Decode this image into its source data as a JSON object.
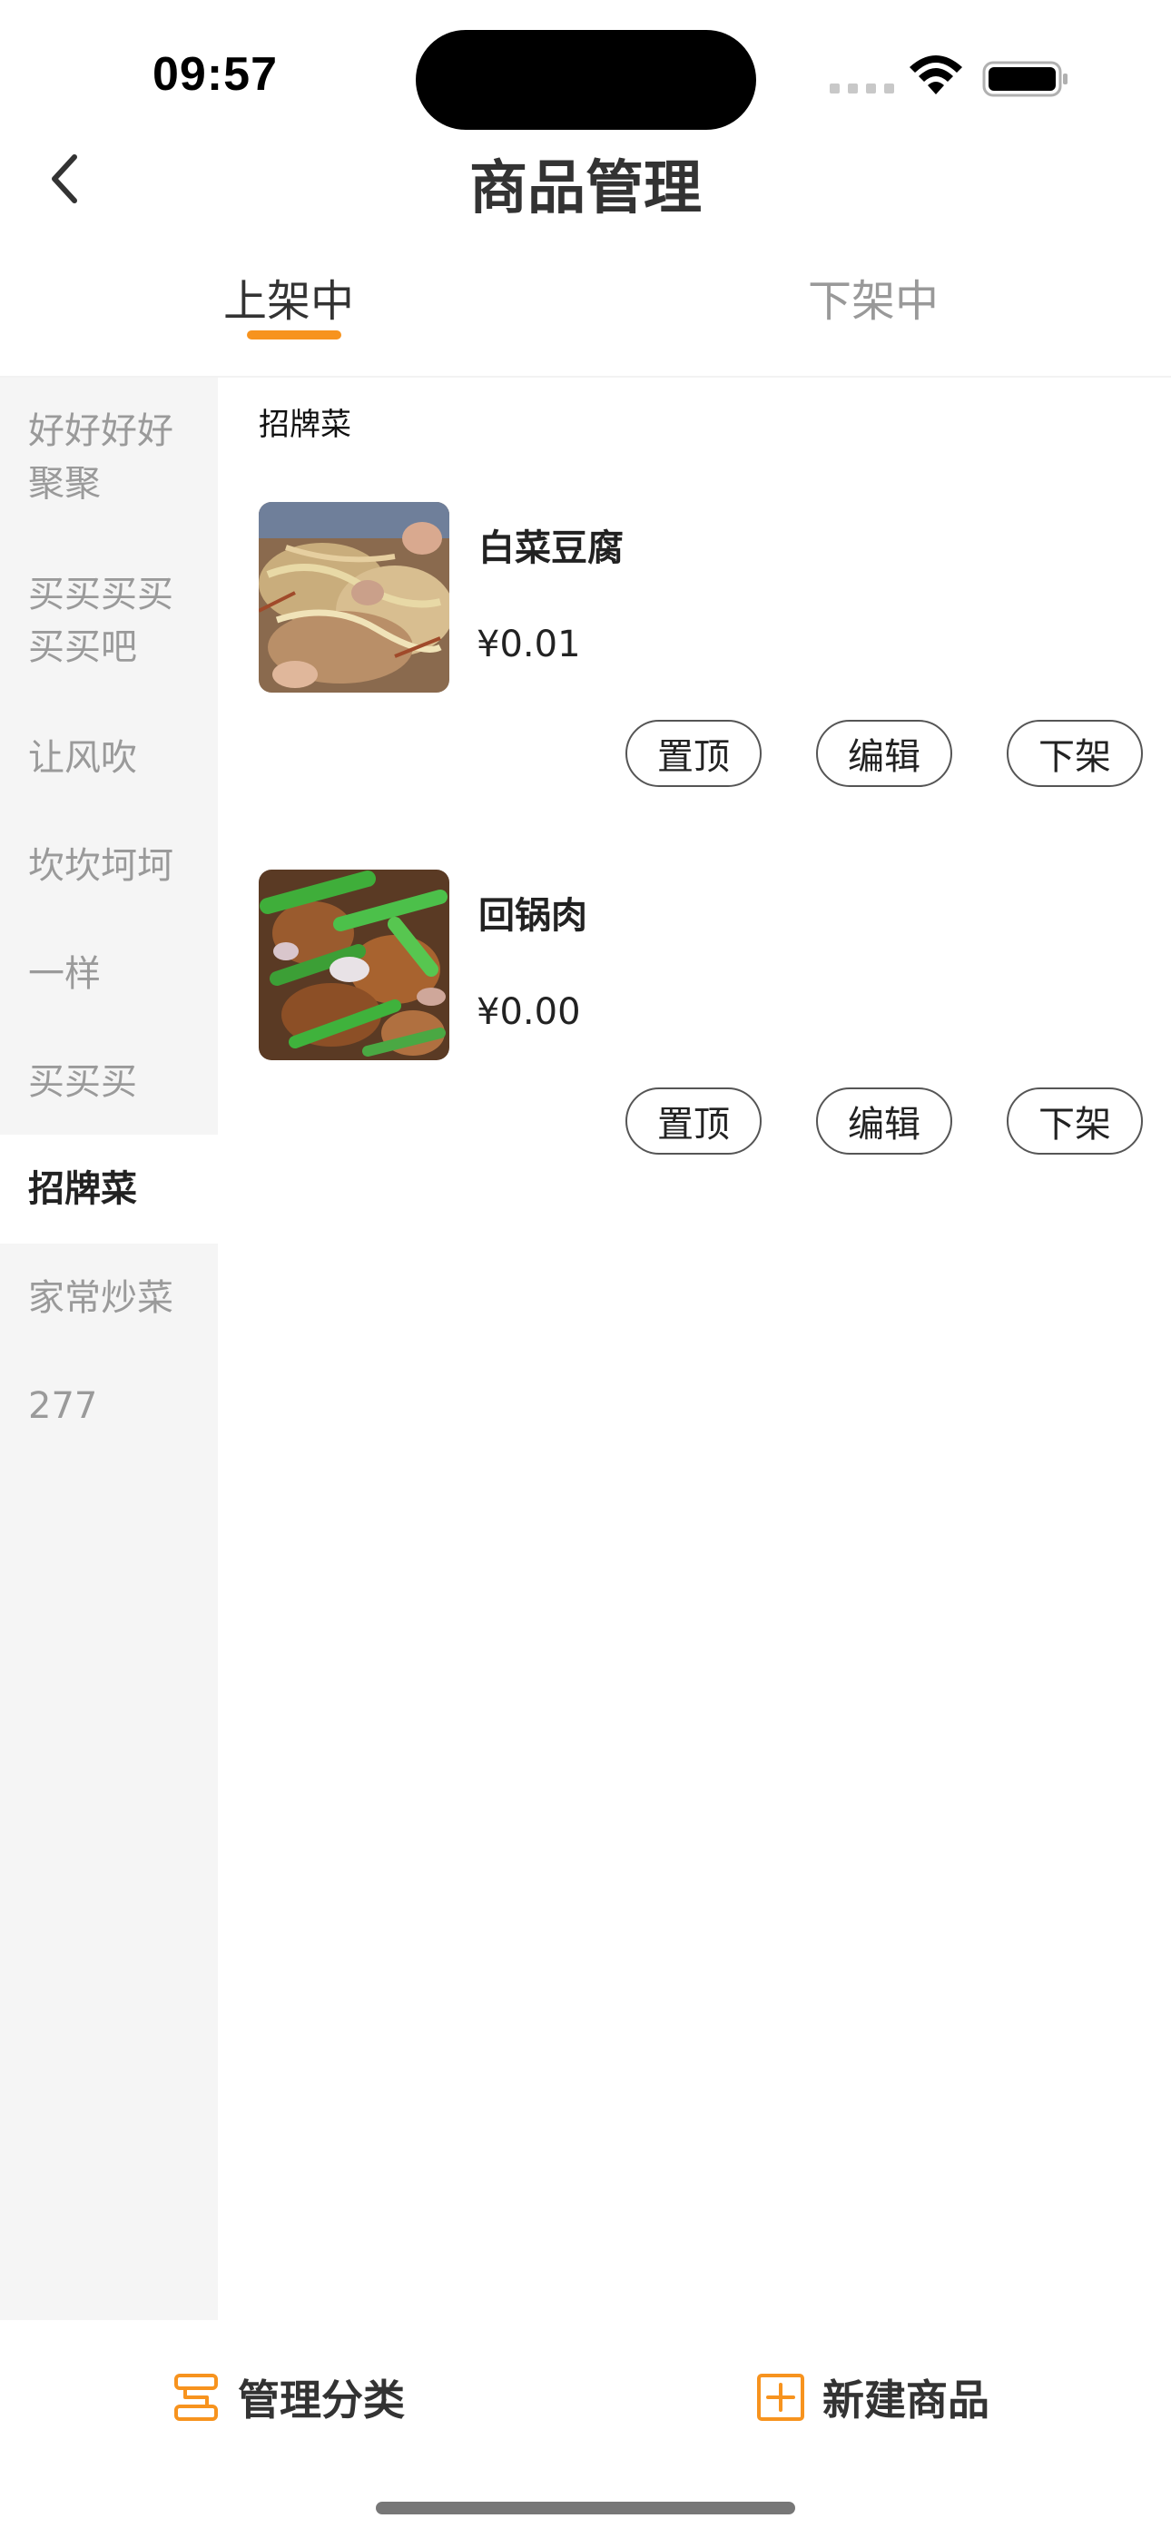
{
  "status_bar": {
    "time": "09:57"
  },
  "nav": {
    "title": "商品管理",
    "back_icon": "chevron-left-icon"
  },
  "tabs": [
    {
      "label": "上架中",
      "active": true
    },
    {
      "label": "下架中",
      "active": false
    }
  ],
  "colors": {
    "accent": "#f7931e",
    "sidebar_bg": "#f5f5f5",
    "muted_text": "#9a9a9a"
  },
  "sidebar": {
    "items": [
      {
        "label": "好好好好聚聚",
        "active": false
      },
      {
        "label": "买买买买买买吧",
        "active": false
      },
      {
        "label": "让风吹",
        "active": false
      },
      {
        "label": "坎坎坷坷",
        "active": false
      },
      {
        "label": "一样",
        "active": false
      },
      {
        "label": "买买买",
        "active": false
      },
      {
        "label": "招牌菜",
        "active": true
      },
      {
        "label": "家常炒菜",
        "active": false
      },
      {
        "label": "277",
        "active": false
      }
    ]
  },
  "content": {
    "section_title": "招牌菜",
    "products": [
      {
        "name": "白菜豆腐",
        "price": "¥0.01",
        "actions": {
          "pin": "置顶",
          "edit": "编辑",
          "unlist": "下架"
        }
      },
      {
        "name": "回锅肉",
        "price": "¥0.00",
        "actions": {
          "pin": "置顶",
          "edit": "编辑",
          "unlist": "下架"
        }
      }
    ]
  },
  "bottom_bar": {
    "manage_categories": {
      "label": "管理分类",
      "icon": "category-list-icon"
    },
    "new_product": {
      "label": "新建商品",
      "icon": "plus-square-icon"
    }
  }
}
